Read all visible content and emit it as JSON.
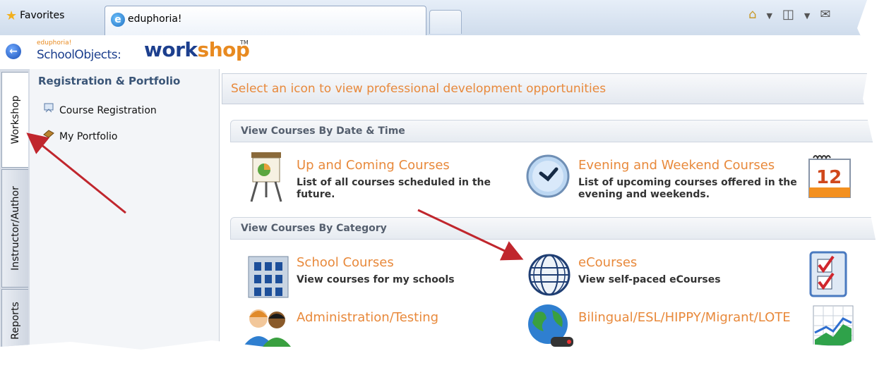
{
  "browser": {
    "favorites_label": "Favorites",
    "tab_title": "eduphoria!"
  },
  "app": {
    "logo_prefix": "eduphoria!",
    "logo_product": "SchoolObjects:",
    "logo_work": "work",
    "logo_shop": "shop",
    "logo_tm": "TM"
  },
  "vertical_tabs": [
    "Workshop",
    "Instructor/Author",
    "Reports"
  ],
  "sidebar": {
    "heading": "Registration & Portfolio",
    "items": [
      {
        "label": "Course Registration",
        "icon": "course-registration-icon"
      },
      {
        "label": "My Portfolio",
        "icon": "portfolio-icon"
      }
    ]
  },
  "main": {
    "banner": "Select an icon to view professional development opportunities",
    "sections": [
      {
        "title": "View Courses By Date & Time",
        "courses": [
          {
            "title": "Up and Coming Courses",
            "desc": "List of all courses scheduled in the future.",
            "icon": "presentation-board-icon"
          },
          {
            "title": "Evening and Weekend Courses",
            "desc": "List of upcoming courses offered in the evening and weekends.",
            "icon": "clock-icon"
          },
          {
            "title": "",
            "desc": "",
            "icon": "calendar-icon"
          }
        ]
      },
      {
        "title": "View Courses By Category",
        "courses": [
          {
            "title": "School Courses",
            "desc": "View courses for my schools",
            "icon": "building-icon"
          },
          {
            "title": "eCourses",
            "desc": "View self-paced eCourses",
            "icon": "globe-icon"
          },
          {
            "title": "",
            "desc": "",
            "icon": "checklist-icon"
          },
          {
            "title": "Administration/Testing",
            "desc": "",
            "icon": "people-icon"
          },
          {
            "title": "Bilingual/ESL/HIPPY/Migrant/LOTE",
            "desc": "",
            "icon": "earth-icon"
          },
          {
            "title": "",
            "desc": "",
            "icon": "chart-icon"
          }
        ]
      }
    ]
  },
  "colors": {
    "accent_orange": "#e8893b",
    "brand_blue": "#1c3f8e",
    "annotation_red": "#c0262d"
  }
}
